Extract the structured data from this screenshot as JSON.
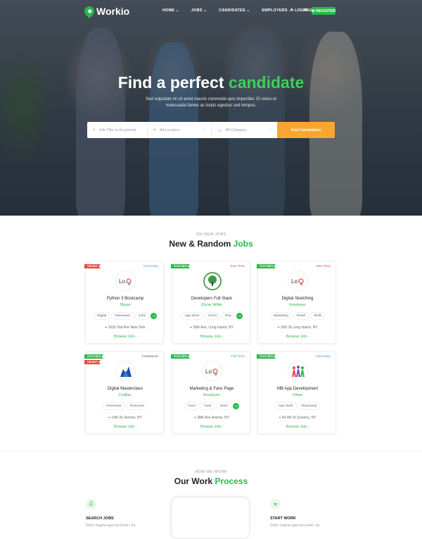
{
  "brand": {
    "name": "Workio"
  },
  "nav": {
    "items": [
      "HOME ⌄",
      "JOBS ⌄",
      "CANDIDATES ⌄",
      "EMPLOYERS ⌄",
      "PAGES ⌄"
    ],
    "login": "LOGIN",
    "register": "REGISTER"
  },
  "hero": {
    "title_pre": "Find a perfect ",
    "title_hl": "candidate",
    "subtitle": "Sed vulputate mi sit amet mauris commodo quis imperdiet. Et netus et malesuada fames ac turpis egestas sed tempus."
  },
  "search": {
    "keywords_placeholder": "Job Title or Keywords",
    "location_placeholder": "All Location",
    "category_placeholder": "All Category",
    "button": "Find Candidates"
  },
  "jobs_section": {
    "eyebrow": "200 NEW JOBS",
    "title_pre": "New & Random ",
    "title_hl": "Jobs",
    "browse": "Browse Job ›",
    "cards": [
      {
        "tags": [
          "URGENT"
        ],
        "type": "Internship",
        "type_color": "#4aa3df",
        "logo": "logo",
        "title": "Python 3 Bootcamp",
        "company": "Skype",
        "skills": [
          "Digital",
          "Interviews",
          "Jobs"
        ],
        "plus": "+3",
        "location": "1629 2nd Ave New York"
      },
      {
        "tags": [
          "FEATURED"
        ],
        "type": "Part Time",
        "type_color": "#e84646",
        "logo": "tree",
        "title": "Developers Full Stack",
        "company": "Oscar Wilde",
        "skills": [
          "App Work",
          "CSS3",
          "Php"
        ],
        "plus": "+3",
        "location": "30th Ave, Long Island, NY"
      },
      {
        "tags": [
          "FEATURED"
        ],
        "type": "Part Time",
        "type_color": "#e84646",
        "logo": "logo",
        "title": "Digital Sketching",
        "company": "Employer",
        "skills": [
          "Marketing",
          "Retail",
          "Skills"
        ],
        "plus": "",
        "location": "10th St Long Island, NY"
      },
      {
        "tags": [
          "FEATURED",
          "URGENT"
        ],
        "type": "Freelancer",
        "type_color": "#555555",
        "logo": "building",
        "title": "Digital Masterclass",
        "company": "Codilac",
        "skills": [
          "Interviews",
          "Resumes"
        ],
        "plus": "",
        "location": "14th St, Astoria, NY"
      },
      {
        "tags": [
          "FEATURED"
        ],
        "type": "Full Time",
        "type_color": "#2bb74a",
        "logo": "logo",
        "title": "Marketing & Fans Page",
        "company": "Employer",
        "skills": [
          "Face",
          "Fans",
          "Likes"
        ],
        "plus": "+3",
        "location": "38th Ave Astoria, NY"
      },
      {
        "tags": [
          "FEATURED"
        ],
        "type": "Internship",
        "type_color": "#4aa3df",
        "logo": "people",
        "title": "MB App Development",
        "company": "Virtue",
        "skills": [
          "App Work",
          "Bootcamp"
        ],
        "plus": "",
        "location": "64 9th St Queens, NY"
      }
    ]
  },
  "work_section": {
    "eyebrow": "HOW WE WORK",
    "title_pre": "Our Work ",
    "title_hl": "Process",
    "steps": [
      {
        "icon": "search-doc-icon",
        "title": "SEARCH JOBS",
        "text": "Dolor magna eget est lorem. Eu"
      },
      {
        "icon": "layers-icon",
        "title": "START WORK",
        "text": "Dolor magna eget est lorem. Eu"
      }
    ]
  },
  "colors": {
    "accent": "#2bb74a",
    "button": "#f8a631",
    "urgent": "#e84646"
  }
}
